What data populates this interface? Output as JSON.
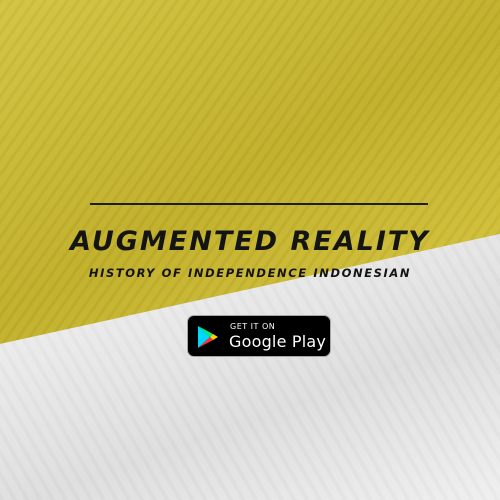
{
  "colors": {
    "yellow": "#cfbd2c",
    "white": "#ececec",
    "ink": "#141414"
  },
  "header": {
    "title": "AUGMENTED REALITY",
    "subtitle": "HISTORY OF INDEPENDENCE INDONESIAN"
  },
  "badge": {
    "small_text": "GET IT ON",
    "big_text": "Google Play",
    "icon": "google-play-icon"
  }
}
